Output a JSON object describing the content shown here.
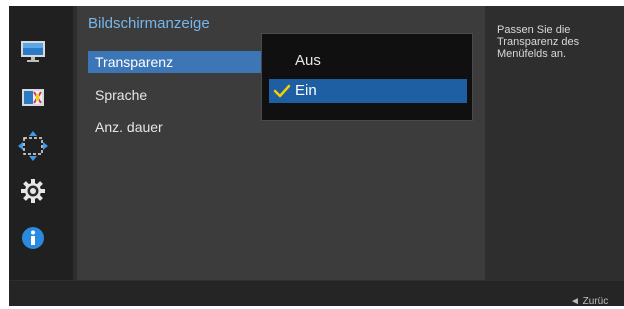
{
  "menu": {
    "title": "Bildschirmanzeige",
    "items": [
      {
        "label": "Transparenz",
        "selected": true
      },
      {
        "label": "Sprache",
        "selected": false
      },
      {
        "label": "Anz. dauer",
        "selected": false
      }
    ]
  },
  "popup": {
    "options": [
      {
        "label": "Aus",
        "selected": false
      },
      {
        "label": "Ein",
        "selected": true
      }
    ]
  },
  "help": {
    "text": "Passen Sie die Transparenz des Menüfelds an."
  },
  "footer": {
    "back_label": "◄  Zurüc"
  },
  "sidebar": {
    "icons": [
      "monitor-icon",
      "color-adjust-icon",
      "position-size-icon",
      "gear-icon",
      "info-icon"
    ]
  },
  "colors": {
    "accent": "#3d76b7",
    "title": "#78b6ea",
    "check": "#f5d000"
  }
}
